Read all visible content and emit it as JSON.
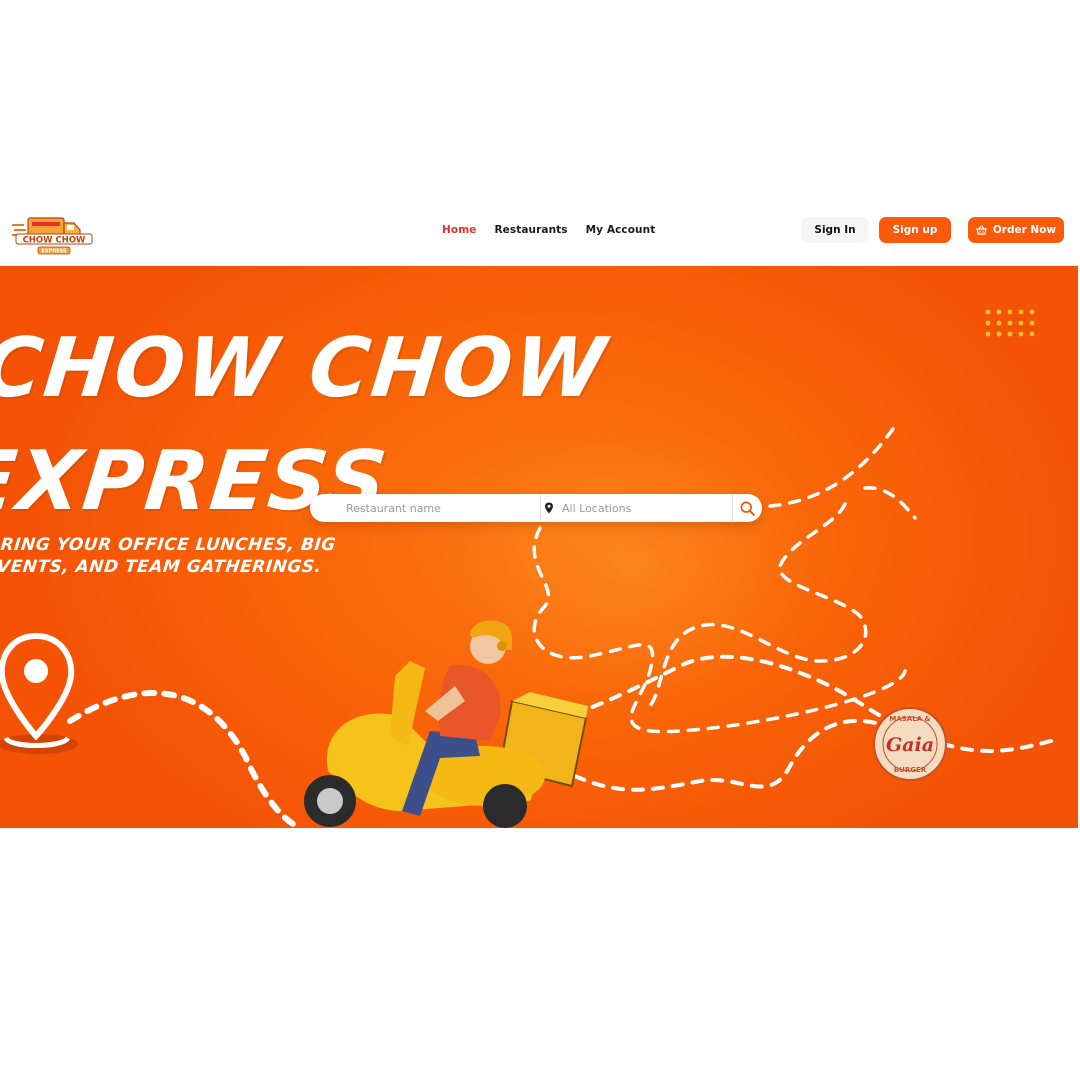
{
  "brand": {
    "name": "CHOW CHOW EXPRESS",
    "logo_text_top": "CHOW CHOW",
    "logo_text_bottom": "EXPRESS"
  },
  "nav": {
    "links": [
      {
        "label": "Home",
        "active": true
      },
      {
        "label": "Restaurants",
        "active": false
      },
      {
        "label": "My Account",
        "active": false
      }
    ]
  },
  "actions": {
    "signin_label": "Sign In",
    "signup_label": "Sign up",
    "order_label": "Order Now",
    "order_icon": "basket-icon"
  },
  "hero": {
    "title_line1": "CHOW CHOW",
    "title_line2": "EXPRESS",
    "subtitle_line1": "BRING YOUR OFFICE LUNCHES, BIG",
    "subtitle_line2": "EVENTS, AND TEAM GATHERINGS.",
    "badge_top": "MASALA &",
    "badge_main": "Gaia",
    "badge_bottom": "BURGER"
  },
  "search": {
    "restaurant_placeholder": "Restaurant name",
    "location_placeholder": "All Locations",
    "location_icon": "map-pin-icon",
    "button_icon": "search-icon"
  },
  "colors": {
    "accent": "#fa5a0c",
    "active_link": "#e2322b",
    "hero_bg": "#f96408",
    "scooter": "#f6c21c",
    "dots": "#f7c42a"
  }
}
